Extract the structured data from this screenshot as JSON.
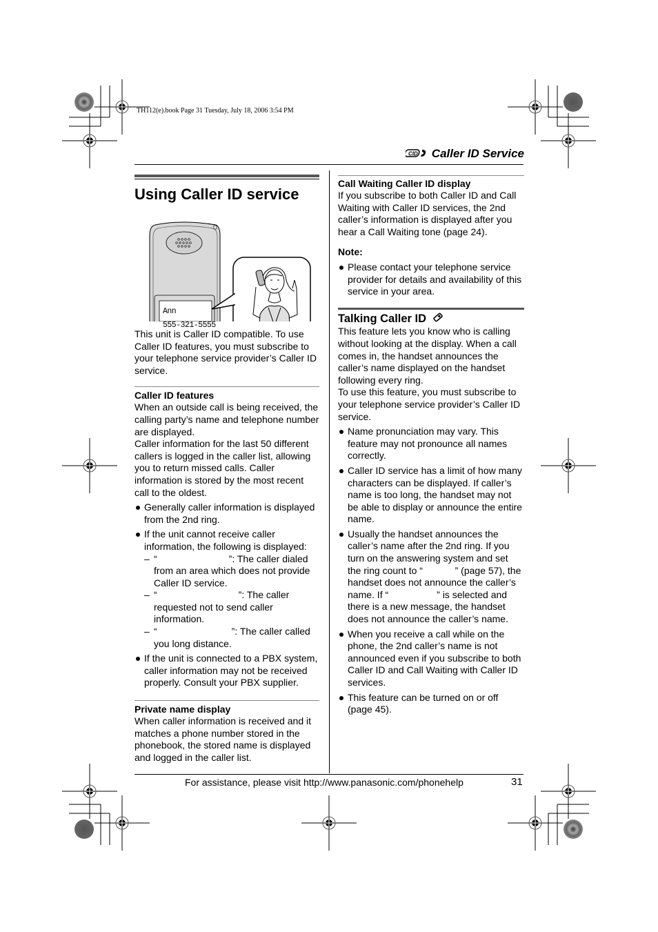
{
  "print_marks": {
    "slug_line": "TH112(e).book  Page 31  Tuesday, July 18, 2006  3:54 PM"
  },
  "running_head": {
    "icon": "caller-id-phone-icon",
    "icon_text": "CID",
    "title": "Caller ID Service"
  },
  "left_column": {
    "title": "Using Caller ID service",
    "illustration": {
      "display_name": "Ann",
      "display_number": "555-321-5555"
    },
    "intro": "This unit is Caller ID compatible. To use Caller ID features, you must subscribe to your telephone service provider’s Caller ID service.",
    "caller_id_features": {
      "heading": "Caller ID features",
      "para1": "When an outside call is being received, the calling party’s name and telephone number are displayed.",
      "para2": "Caller information for the last 50 different callers is logged in the caller list, allowing you to return missed calls. Caller information is stored by the most recent call to the oldest.",
      "bullet1": "Generally caller information is displayed from the 2nd ring.",
      "bullet2": "If the unit cannot receive caller information, the following is displayed:",
      "dash_items": [
        {
          "dash": "–",
          "open_quote": "“",
          "blank": "",
          "close_text": "”: The caller dialed from an area which does not provide Caller ID service."
        },
        {
          "dash": "–",
          "open_quote": "“",
          "blank": "",
          "close_text": "”: The caller requested not to send caller information."
        },
        {
          "dash": "–",
          "open_quote": "“",
          "blank": "",
          "close_text": "”: The caller called you long distance."
        }
      ],
      "bullet3": "If the unit is connected to a PBX system, caller information may not be received properly. Consult your PBX supplier."
    },
    "private_name": {
      "heading": "Private name display",
      "para": "When caller information is received and it matches a phone number stored in the phonebook, the stored name is displayed and logged in the caller list."
    }
  },
  "right_column": {
    "call_waiting": {
      "heading": "Call Waiting Caller ID display",
      "para": "If you subscribe to both Caller ID and Call Waiting with Caller ID services, the 2nd caller’s information is displayed after you hear a Call Waiting tone (page 24)."
    },
    "note": {
      "label": "Note:",
      "bullet": "Please contact your telephone service provider for details and availability of this service in your area."
    },
    "talking_caller_id": {
      "heading": "Talking Caller ID",
      "heading_icon": "handset-icon",
      "para1": "This feature lets you know who is calling without looking at the display. When a call comes in, the handset announces the caller’s name displayed on the handset following every ring.",
      "para2": "To use this feature, you must subscribe to your telephone service provider’s Caller ID service.",
      "bullets": [
        "Name pronunciation may vary. This feature may not pronounce all names correctly.",
        "Caller ID service has a limit of how many characters can be displayed. If caller’s name is too long, the handset may not be able to display or announce the entire name.",
        "Usually the handset announces the caller’s name after the 2nd ring. If you turn on the answering system and set the ring count to “            ” (page 57), the handset does not announce the caller’s name. If “                  ” is selected and there is a new message, the handset does not announce the caller’s name.",
        "When you receive a call while on the phone, the 2nd caller’s name is not announced even if you subscribe to both Caller ID and Call Waiting with Caller ID services.",
        "This feature can be turned on or off (page 45)."
      ]
    }
  },
  "footer": {
    "assistance": "For assistance, please visit http://www.panasonic.com/phonehelp",
    "page_number": "31"
  }
}
